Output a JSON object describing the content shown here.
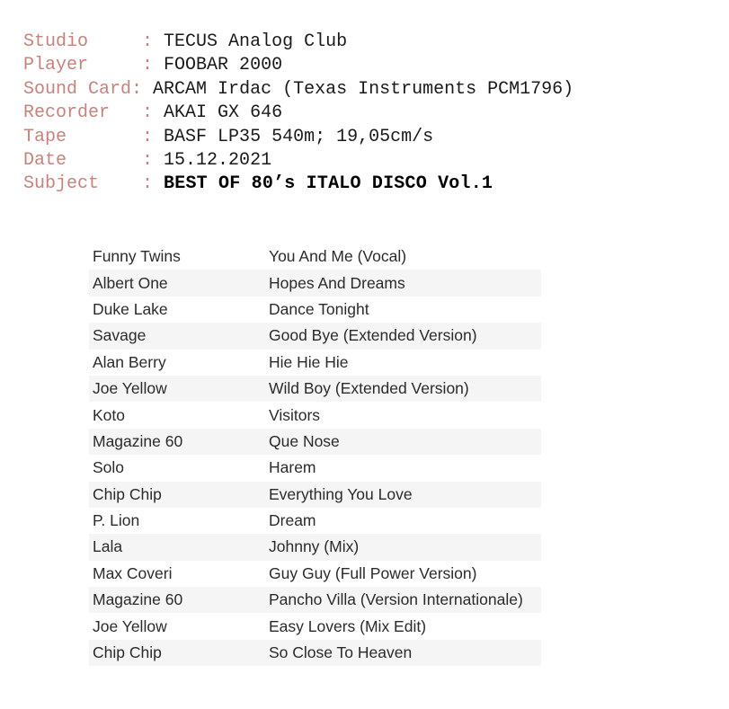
{
  "document": {
    "type": "tape-recording-tracklist",
    "background_color": "#ffffff",
    "label_color": "#c4837c",
    "value_color": "#1a1a1a",
    "stripe_color": "#f5f5f5"
  },
  "info": {
    "separator": ": ",
    "rows": [
      {
        "label": "Studio     ",
        "sep": ": ",
        "value": "TECUS Analog Club",
        "bold": false
      },
      {
        "label": "Player     ",
        "sep": ": ",
        "value": "FOOBAR 2000",
        "bold": false
      },
      {
        "label": "Sound Card",
        "sep": ": ",
        "value": "ARCAM Irdac (Texas Instruments PCM1796)",
        "bold": false
      },
      {
        "label": "Recorder   ",
        "sep": ": ",
        "value": "AKAI GX 646",
        "bold": false
      },
      {
        "label": "Tape       ",
        "sep": ": ",
        "value": "BASF LP35 540m; 19,05cm/s",
        "bold": false
      },
      {
        "label": "Date       ",
        "sep": ": ",
        "value": "15.12.2021",
        "bold": false
      },
      {
        "label": "Subject    ",
        "sep": ": ",
        "value": "BEST OF 80’s ITALO DISCO Vol.1",
        "bold": true
      }
    ]
  },
  "tracklist": {
    "tracks": [
      {
        "artist": "Funny Twins",
        "title": "You And Me (Vocal)"
      },
      {
        "artist": "Albert One",
        "title": "Hopes And Dreams"
      },
      {
        "artist": "Duke Lake",
        "title": "Dance Tonight"
      },
      {
        "artist": "Savage",
        "title": "Good Bye (Extended Version)"
      },
      {
        "artist": "Alan Berry",
        "title": "Hie Hie Hie"
      },
      {
        "artist": "Joe Yellow",
        "title": "Wild Boy (Extended Version)"
      },
      {
        "artist": "Koto",
        "title": "Visitors"
      },
      {
        "artist": "Magazine 60",
        "title": "Que Nose"
      },
      {
        "artist": "Solo",
        "title": "Harem"
      },
      {
        "artist": "Chip Chip",
        "title": "Everything You Love"
      },
      {
        "artist": "P. Lion",
        "title": "Dream"
      },
      {
        "artist": "Lala",
        "title": "Johnny (Mix)"
      },
      {
        "artist": "Max Coveri",
        "title": "Guy Guy (Full Power Version)"
      },
      {
        "artist": "Magazine 60",
        "title": "Pancho Villa (Version Internationale)"
      },
      {
        "artist": "Joe Yellow",
        "title": "Easy Lovers (Mix Edit)"
      },
      {
        "artist": "Chip Chip",
        "title": "So Close To Heaven"
      }
    ]
  }
}
